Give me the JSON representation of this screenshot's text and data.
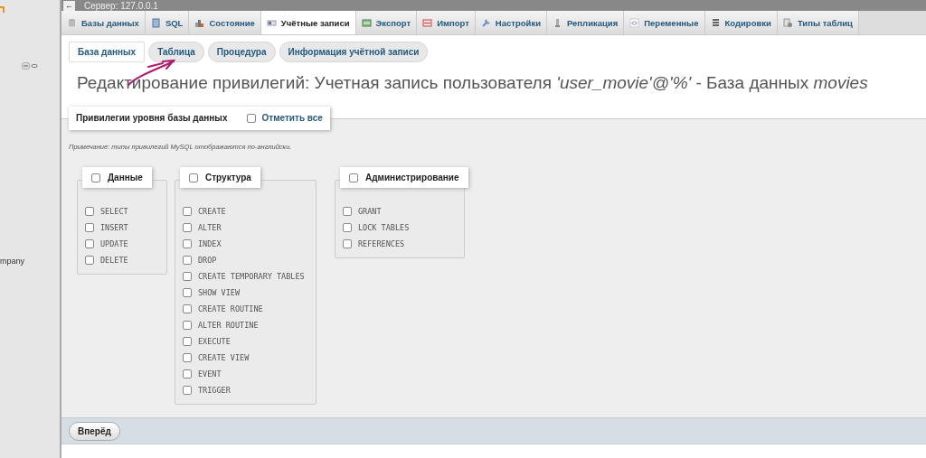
{
  "top_bar": {
    "back": "←",
    "server": "Сервер: 127.0.0.1"
  },
  "sidebar": {
    "text": "mpany"
  },
  "tabs": [
    {
      "label": "Базы данных",
      "selected": false
    },
    {
      "label": "SQL",
      "selected": false
    },
    {
      "label": "Состояние",
      "selected": false
    },
    {
      "label": "Учётные записи",
      "selected": true
    },
    {
      "label": "Экспорт",
      "selected": false
    },
    {
      "label": "Импорт",
      "selected": false
    },
    {
      "label": "Настройки",
      "selected": false
    },
    {
      "label": "Репликация",
      "selected": false
    },
    {
      "label": "Переменные",
      "selected": false
    },
    {
      "label": "Кодировки",
      "selected": false
    },
    {
      "label": "Типы таблиц",
      "selected": false
    }
  ],
  "subtabs": [
    {
      "label": "База данных",
      "selected": true
    },
    {
      "label": "Таблица",
      "selected": false
    },
    {
      "label": "Процедура",
      "selected": false
    },
    {
      "label": "Информация учётной записи",
      "selected": false
    }
  ],
  "title": "Редактирование привилегий: Учетная запись пользователя *'user_movie'@'%'* - База данных *movies*",
  "privileges": {
    "legend": "Привилегии уровня базы данных",
    "check_all": {
      "label": "Отметить все",
      "checked": false
    },
    "note": "Примечание: типы привилегий MySQL отображаются по-английски.",
    "groups": [
      {
        "title": "Данные",
        "checked": false,
        "items": [
          {
            "label": "SELECT",
            "checked": false
          },
          {
            "label": "INSERT",
            "checked": false
          },
          {
            "label": "UPDATE",
            "checked": false
          },
          {
            "label": "DELETE",
            "checked": false
          }
        ]
      },
      {
        "title": "Структура",
        "checked": false,
        "items": [
          {
            "label": "CREATE",
            "checked": false
          },
          {
            "label": "ALTER",
            "checked": false
          },
          {
            "label": "INDEX",
            "checked": false
          },
          {
            "label": "DROP",
            "checked": false
          },
          {
            "label": "CREATE TEMPORARY TABLES",
            "checked": false
          },
          {
            "label": "SHOW VIEW",
            "checked": false
          },
          {
            "label": "CREATE ROUTINE",
            "checked": false
          },
          {
            "label": "ALTER ROUTINE",
            "checked": false
          },
          {
            "label": "EXECUTE",
            "checked": false
          },
          {
            "label": "CREATE VIEW",
            "checked": false
          },
          {
            "label": "EVENT",
            "checked": false
          },
          {
            "label": "TRIGGER",
            "checked": false
          }
        ]
      },
      {
        "title": "Администрирование",
        "checked": false,
        "items": [
          {
            "label": "GRANT",
            "checked": false
          },
          {
            "label": "LOCK TABLES",
            "checked": false
          },
          {
            "label": "REFERENCES",
            "checked": false
          }
        ]
      }
    ]
  },
  "footer": {
    "button": "Вперёд"
  }
}
